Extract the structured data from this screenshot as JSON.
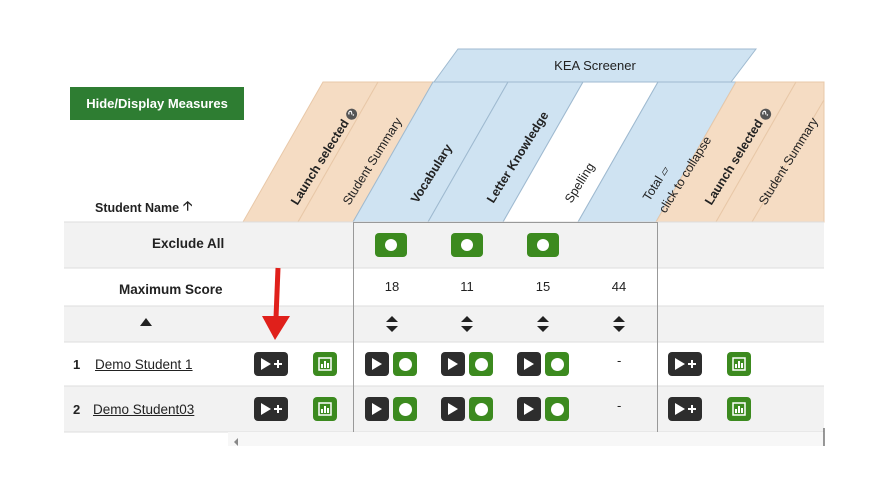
{
  "toolbar": {
    "hide_display_label": "Hide/Display Measures"
  },
  "group": {
    "title": "KEA Screener"
  },
  "columns": [
    {
      "label": "Launch selected"
    },
    {
      "label": "Student Summary"
    },
    {
      "label": "Vocabulary"
    },
    {
      "label": "Letter Knowledge"
    },
    {
      "label": "Spelling"
    },
    {
      "label": "Total",
      "sub": "click to collapse"
    },
    {
      "label": "Launch selected"
    },
    {
      "label": "Student Summary"
    }
  ],
  "table": {
    "student_name_header": "Student Name",
    "exclude_all_label": "Exclude All",
    "max_score_label": "Maximum Score",
    "max_scores": [
      "18",
      "11",
      "15",
      "44"
    ],
    "rows": [
      {
        "num": "1",
        "name": "Demo Student 1",
        "total": "-"
      },
      {
        "num": "2",
        "name": "Demo Student03",
        "total": "-"
      }
    ]
  },
  "colors": {
    "tan": "#f5dcc3",
    "blue": "#cfe3f2",
    "green": "#3c8a1f",
    "dark_green": "#2e7d32",
    "dark_button": "#2d2d2d",
    "red_arrow": "#e0201b"
  }
}
